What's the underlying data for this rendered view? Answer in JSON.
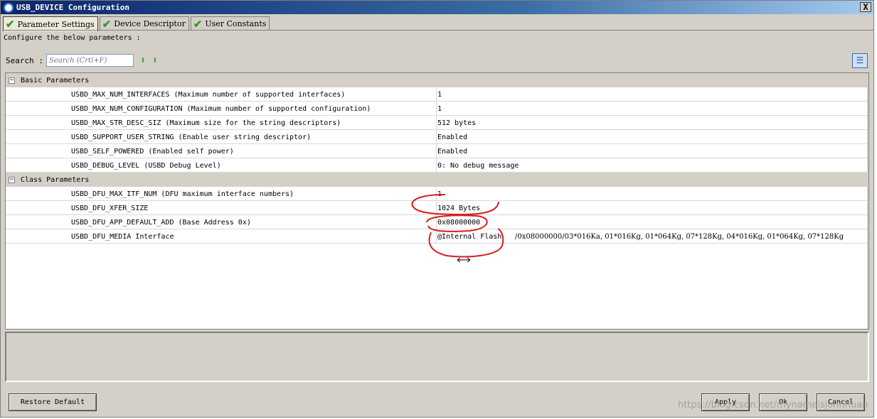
{
  "window": {
    "title": "USB_DEVICE Configuration",
    "close_label": "X"
  },
  "tabs": [
    {
      "label": "Parameter Settings",
      "active": true
    },
    {
      "label": "Device Descriptor",
      "active": false
    },
    {
      "label": "User Constants",
      "active": false
    }
  ],
  "configure_text": "Configure the below parameters :",
  "search": {
    "label": "Search :",
    "placeholder": "Search (Crtl+F)"
  },
  "groups": [
    {
      "label": "Basic Parameters",
      "rows": [
        {
          "name": "USBD_MAX_NUM_INTERFACES  (Maximum number of supported interfaces)",
          "value": "1"
        },
        {
          "name": "USBD_MAX_NUM_CONFIGURATION  (Maximum number of supported configuration)",
          "value": "1"
        },
        {
          "name": "USBD_MAX_STR_DESC_SIZ  (Maximum size for the string descriptors)",
          "value": "512 bytes"
        },
        {
          "name": "USBD_SUPPORT_USER_STRING  (Enable user string descriptor)",
          "value": "Enabled"
        },
        {
          "name": "USBD_SELF_POWERED  (Enabled self power)",
          "value": "Enabled"
        },
        {
          "name": "USBD_DEBUG_LEVEL  (USBD Debug Level)",
          "value": "0: No debug message"
        }
      ]
    },
    {
      "label": "Class Parameters",
      "rows": [
        {
          "name": "USBD_DFU_MAX_ITF_NUM  (DFU maximum interface numbers)",
          "value": "1"
        },
        {
          "name": "USBD_DFU_XFER_SIZE",
          "value": "1024 Bytes"
        },
        {
          "name": "USBD_DFU_APP_DEFAULT_ADD  (Base Address 0x)",
          "value": "0x08000000"
        },
        {
          "name": "USBD_DFU_MEDIA Interface",
          "value": "@Internal Flash",
          "value2": "/0x08000000/03*016Ka, 01*016Kg, 01*064Kg, 07*128Kg, 04*016Kg, 01*064Kg, 07*128Kg"
        }
      ]
    }
  ],
  "buttons": {
    "restore_default": "Restore Default",
    "apply": "Apply",
    "ok": "Ok",
    "cancel": "Cancel"
  },
  "watermark": "https://blog.csdn.net/mynameisjohnhuan",
  "colors": {
    "titlebar": "#0a246a",
    "window_bg": "#d4d0c8",
    "check_green": "#2e9a2e",
    "annotation_red": "#d42020"
  },
  "icons": {
    "tab_status": "green-check-icon",
    "search_next": "arrow-down-icon",
    "search_prev": "arrow-up-icon",
    "view_toggle": "list-view-icon"
  }
}
